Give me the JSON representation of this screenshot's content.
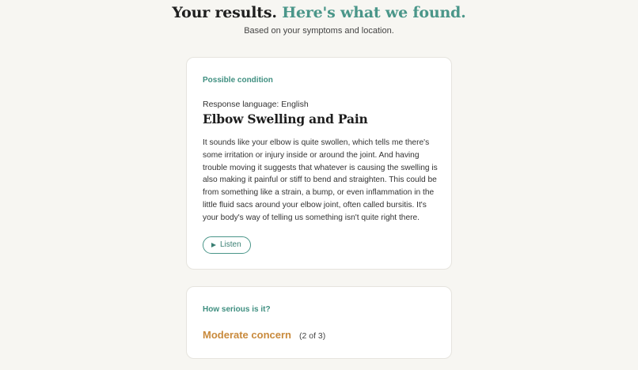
{
  "header": {
    "title_prefix": "Your results.",
    "title_accent": "Here's what we found.",
    "subtitle": "Based on your symptoms and location."
  },
  "condition_card": {
    "eyebrow": "Possible condition",
    "language_line": "Response language: English",
    "title": "Elbow Swelling and Pain",
    "description": "It sounds like your elbow is quite swollen, which tells me there's some irritation or injury inside or around the joint. And having trouble moving it suggests that whatever is causing the swelling is also making it painful or stiff to bend and straighten. This could be from something like a strain, a bump, or even inflammation in the little fluid sacs around your elbow joint, often called bursitis. It's your body's way of telling us something isn't quite right there.",
    "listen_label": "Listen",
    "listen_icon": "play-icon"
  },
  "severity_card": {
    "eyebrow": "How serious is it?",
    "level_label": "Moderate concern",
    "level_count": "(2 of 3)"
  },
  "colors": {
    "accent_teal": "#4a9689",
    "severity_orange": "#c98a3c",
    "background": "#f7f6f2"
  }
}
